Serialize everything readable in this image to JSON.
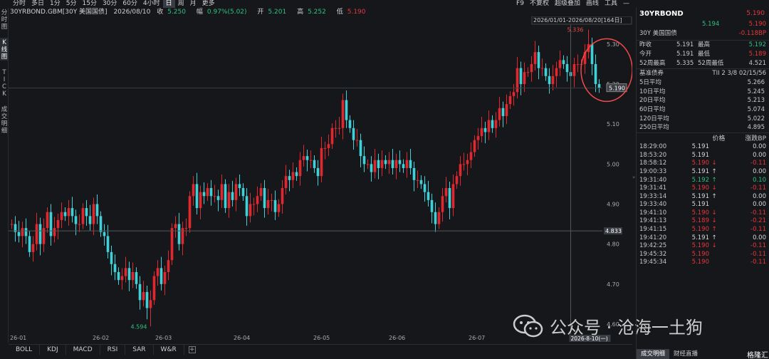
{
  "toolbar": {
    "periods": [
      "分时",
      "多日",
      "1分",
      "5分",
      "15分",
      "30分",
      "60分",
      "4小时",
      "日",
      "周",
      "月",
      "更多"
    ],
    "active_index": 8,
    "tools": [
      "F9",
      "不复权",
      "超级叠加",
      "画线",
      "工具"
    ],
    "minimize_icon": "minus-icon"
  },
  "quote": {
    "code": "30YRBOND.GBM[30Y 美国国债]",
    "date": "2026/08/10",
    "close_label": "收",
    "close": "5.250",
    "chg_label": "幅",
    "chg": "0.97%(5.02)",
    "open_label": "开",
    "open": "5.201",
    "high_label": "高",
    "high": "5.252",
    "low_label": "低",
    "low": "5.190"
  },
  "left_tabs": [
    "分时图",
    "K线图",
    "TICK",
    "成交明细"
  ],
  "left_active": 1,
  "chart": {
    "range_label": "2026/01/01-2026/08/20[164日]",
    "x_labels": [
      "26-01",
      "26-02",
      "26-03",
      "26-04",
      "26-05",
      "26-06",
      "26-07"
    ],
    "x_cursor_label": "2026-8-10(一)",
    "y_labels": [
      "5.30",
      "5.20",
      "5.10",
      "5.00",
      "4.90",
      "4.80",
      "4.70",
      "4.60"
    ],
    "high_mark": "5.336",
    "low_mark": "4.594",
    "last_price_tag": "5.190",
    "cross_price_tag": "4.833",
    "colors": {
      "up": "#e0282e",
      "down": "#3fd1d8",
      "bg": "#16171b",
      "annot": "#f04a4a"
    }
  },
  "chart_data": {
    "type": "candlestick",
    "opens": [
      4.85,
      4.85,
      4.83,
      4.82,
      4.84,
      4.82,
      4.78,
      4.8,
      4.85,
      4.8,
      4.84,
      4.88,
      4.82,
      4.84,
      4.86,
      4.88,
      4.87,
      4.89,
      4.87,
      4.85,
      4.85,
      4.89,
      4.87,
      4.85,
      4.9,
      4.87,
      4.83,
      4.82,
      4.78,
      4.75,
      4.73,
      4.71,
      4.72,
      4.74,
      4.71,
      4.73,
      4.7,
      4.66,
      4.68,
      4.64,
      4.66,
      4.72,
      4.74,
      4.7,
      4.73,
      4.76,
      4.84,
      4.85,
      4.8,
      4.84,
      4.84,
      4.92,
      4.95,
      4.89,
      4.93,
      4.92,
      4.94,
      4.92,
      4.92,
      4.91,
      4.95,
      4.89,
      4.93,
      4.91,
      4.95,
      4.94,
      4.92,
      4.87,
      4.9,
      4.9,
      4.92,
      4.94,
      4.89,
      4.91,
      4.91,
      4.88,
      4.9,
      4.94,
      4.97,
      4.96,
      4.98,
      4.97,
      5.01,
      5.02,
      5.01,
      5.01,
      4.99,
      4.97,
      5.04,
      5.04,
      5.05,
      5.09,
      5.09,
      5.09,
      5.16,
      5.11,
      5.09,
      5.06,
      5.06,
      5.02,
      5.0,
      5.0,
      4.98,
      5.01,
      4.99,
      5.01,
      5.0,
      5.01,
      4.99,
      5.01,
      5.0,
      4.99,
      5.01,
      4.99,
      4.96,
      4.96,
      4.95,
      4.93,
      4.91,
      4.88,
      4.85,
      4.88,
      4.92,
      4.94,
      4.89,
      4.95,
      4.97,
      5.0,
      5.0,
      5.01,
      5.03,
      5.06,
      5.07,
      5.09,
      5.08,
      5.11,
      5.09,
      5.11,
      5.14,
      5.12,
      5.15,
      5.17,
      5.18,
      5.24,
      5.2,
      5.23,
      5.23,
      5.25,
      5.28,
      5.24,
      5.24,
      5.22,
      5.2,
      5.22,
      5.24,
      5.26,
      5.25,
      5.23,
      5.22,
      5.25,
      5.25,
      5.25,
      5.28,
      5.3,
      5.25,
      5.2
    ],
    "closes": [
      4.85,
      4.83,
      4.82,
      4.84,
      4.82,
      4.78,
      4.8,
      4.85,
      4.8,
      4.84,
      4.88,
      4.82,
      4.84,
      4.86,
      4.88,
      4.87,
      4.89,
      4.87,
      4.85,
      4.85,
      4.89,
      4.87,
      4.85,
      4.9,
      4.87,
      4.83,
      4.82,
      4.78,
      4.75,
      4.73,
      4.71,
      4.72,
      4.74,
      4.71,
      4.73,
      4.7,
      4.66,
      4.68,
      4.64,
      4.66,
      4.72,
      4.74,
      4.7,
      4.73,
      4.76,
      4.84,
      4.85,
      4.8,
      4.84,
      4.84,
      4.92,
      4.95,
      4.89,
      4.93,
      4.92,
      4.94,
      4.92,
      4.92,
      4.91,
      4.95,
      4.89,
      4.93,
      4.91,
      4.95,
      4.94,
      4.92,
      4.87,
      4.9,
      4.9,
      4.92,
      4.94,
      4.89,
      4.91,
      4.91,
      4.88,
      4.9,
      4.94,
      4.97,
      4.96,
      4.98,
      4.97,
      5.01,
      5.02,
      5.01,
      5.01,
      4.99,
      4.97,
      5.04,
      5.04,
      5.05,
      5.09,
      5.09,
      5.09,
      5.16,
      5.11,
      5.09,
      5.06,
      5.06,
      5.02,
      5.0,
      5.0,
      4.98,
      5.01,
      4.99,
      5.01,
      5.0,
      5.01,
      4.99,
      5.01,
      5.0,
      4.99,
      5.01,
      4.99,
      4.96,
      4.96,
      4.95,
      4.93,
      4.91,
      4.88,
      4.85,
      4.88,
      4.92,
      4.94,
      4.89,
      4.95,
      4.97,
      5.0,
      5.0,
      5.01,
      5.03,
      5.06,
      5.07,
      5.09,
      5.08,
      5.11,
      5.09,
      5.11,
      5.14,
      5.12,
      5.15,
      5.17,
      5.18,
      5.24,
      5.2,
      5.23,
      5.23,
      5.25,
      5.28,
      5.24,
      5.24,
      5.22,
      5.2,
      5.22,
      5.24,
      5.26,
      5.25,
      5.23,
      5.22,
      5.25,
      5.25,
      5.25,
      5.28,
      5.3,
      5.25,
      5.2,
      5.19
    ],
    "note": "daily OHLC estimated from candles; high 5.336, low 4.594"
  },
  "right": {
    "symbol": "30YRBOND",
    "last": "5.190",
    "bid": "5.194",
    "ask": "5.190",
    "name": "30Y 美国国债",
    "chg_bp": "-0.118BP",
    "stats": [
      [
        "昨收",
        "5.191",
        "最高",
        "5.192"
      ],
      [
        "今开",
        "5.191",
        "最低",
        "5.189"
      ],
      [
        "52周最高",
        "5.335",
        "52周最低",
        "4.521"
      ]
    ],
    "bench_label": "基准债券",
    "bench": "TII 2 3/8 02/15/56",
    "avgs": [
      [
        "5日平均",
        "5.266"
      ],
      [
        "10日平均",
        "5.245"
      ],
      [
        "20日平均",
        "5.213"
      ],
      [
        "60日平均",
        "5.074"
      ],
      [
        "120日平均",
        "5.022"
      ],
      [
        "250日平均",
        "4.895"
      ]
    ],
    "ticks_header": [
      "价格",
      "涨跌BP"
    ],
    "ticks": [
      [
        "18:29:00",
        "5.191",
        "",
        "0.00",
        "w"
      ],
      [
        "18:53:20",
        "5.191",
        "",
        "0.00",
        "w"
      ],
      [
        "18:58:12",
        "5.190",
        "↓",
        "-0.11",
        "r"
      ],
      [
        "19:00:33",
        "5.191",
        "↑",
        "0.00",
        "w"
      ],
      [
        "19:31:40",
        "5.192",
        "↑",
        "0.10",
        "g"
      ],
      [
        "19:31:41",
        "5.190",
        "↓",
        "-0.11",
        "r"
      ],
      [
        "19:33:14",
        "5.191",
        "↑",
        "0.00",
        "w"
      ],
      [
        "19:33:40",
        "5.191",
        "",
        "0.00",
        "w"
      ],
      [
        "19:41:10",
        "5.190",
        "↓",
        "-0.11",
        "r"
      ],
      [
        "19:41:13",
        "5.189",
        "↓",
        "-0.21",
        "r"
      ],
      [
        "19:41:15",
        "5.190",
        "↑",
        "-0.11",
        "r"
      ],
      [
        "19:41:20",
        "5.191",
        "↑",
        "0.00",
        "w"
      ],
      [
        "19:42:25",
        "5.190",
        "↓",
        "-0.11",
        "r"
      ],
      [
        "19:45:32",
        "5.190",
        "",
        "-0.11",
        "r"
      ],
      [
        "19:45:34",
        "5.190",
        "",
        "-0.11",
        "r"
      ]
    ],
    "tabs": [
      "成交明细",
      "财经直播"
    ],
    "brand": "格隆汇"
  },
  "indicators": [
    "BOLL",
    "KDJ",
    "MACD",
    "RSI",
    "SAR",
    "W&R"
  ],
  "watermark": "公众号 · 沧海一土狗"
}
